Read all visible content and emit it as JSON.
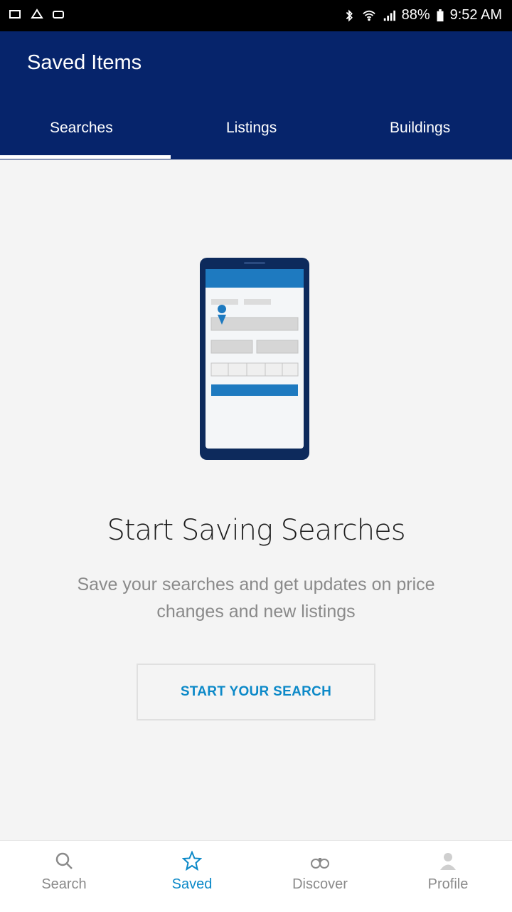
{
  "status_bar": {
    "battery": "88%",
    "time": "9:52 AM"
  },
  "header": {
    "title": "Saved Items",
    "tabs": [
      {
        "label": "Searches",
        "active": true
      },
      {
        "label": "Listings",
        "active": false
      },
      {
        "label": "Buildings",
        "active": false
      }
    ]
  },
  "empty_state": {
    "illustration": "phone-search-form-illustration",
    "headline": "Start Saving Searches",
    "description": "Save your searches and get updates on price changes and new listings",
    "button_label": "START YOUR SEARCH"
  },
  "bottom_nav": {
    "items": [
      {
        "label": "Search",
        "icon": "search-icon",
        "active": false
      },
      {
        "label": "Saved",
        "icon": "star-icon",
        "active": true
      },
      {
        "label": "Discover",
        "icon": "binoculars-icon",
        "active": false
      },
      {
        "label": "Profile",
        "icon": "person-icon",
        "active": false
      }
    ]
  },
  "colors": {
    "header_bg": "#06246b",
    "accent": "#0c89c8",
    "background": "#f4f4f4"
  }
}
